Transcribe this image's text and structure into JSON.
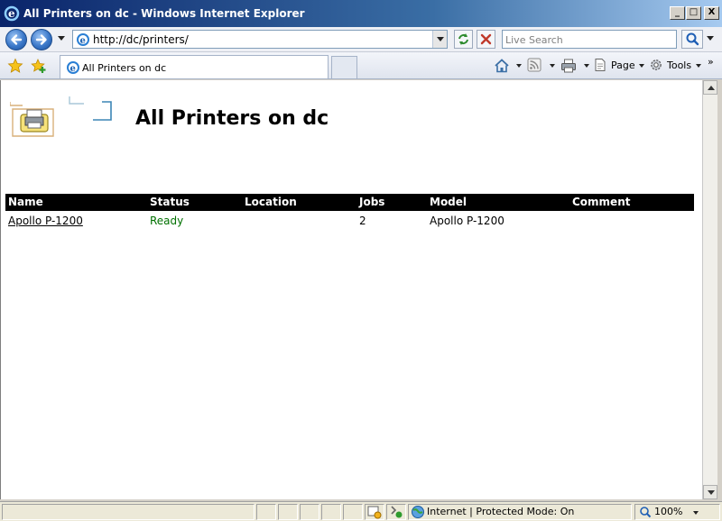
{
  "window": {
    "title": "All Printers on dc - Windows Internet Explorer",
    "min_glyph": "_",
    "max_glyph": "□",
    "close_glyph": "X"
  },
  "address": {
    "url": "http://dc/printers/",
    "search_placeholder": "Live Search"
  },
  "tabs": [
    {
      "label": "All Printers on dc"
    }
  ],
  "commands": {
    "page_label": "Page",
    "tools_label": "Tools",
    "more_glyph": "»"
  },
  "page": {
    "title": "All Printers on dc",
    "table": {
      "columns": [
        "Name",
        "Status",
        "Location",
        "Jobs",
        "Model",
        "Comment"
      ],
      "rows": [
        {
          "name": "Apollo P-1200",
          "status": "Ready",
          "location": "",
          "jobs": "2",
          "model": "Apollo P-1200",
          "comment": ""
        }
      ]
    }
  },
  "status_bar": {
    "zone": "Internet | Protected Mode: On",
    "zoom": "100%"
  },
  "colors": {
    "status_ready": "#007000",
    "table_header_bg": "#000000",
    "titlebar": "#0a246a"
  }
}
